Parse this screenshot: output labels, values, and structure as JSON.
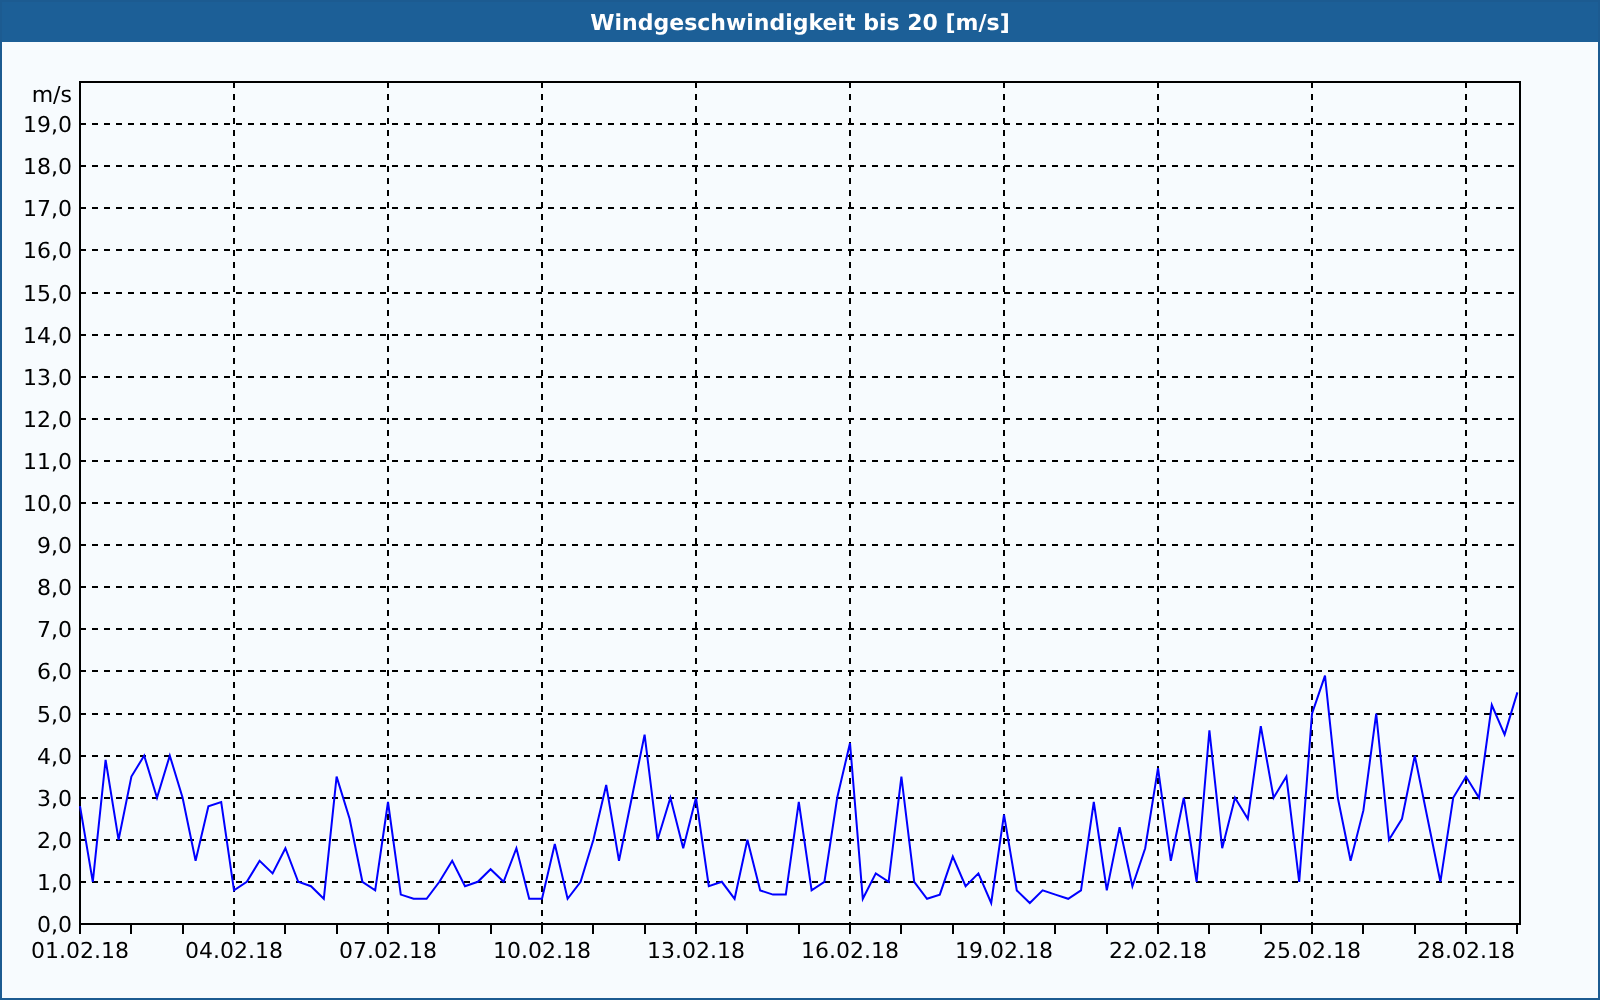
{
  "window": {
    "title": "Windgeschwindigkeit bis 20 [m/s]"
  },
  "chart_data": {
    "type": "line",
    "grid": true,
    "ylabel": "m/s",
    "ylim": [
      0,
      20
    ],
    "yticks": [
      {
        "value": 0,
        "label": "0,0"
      },
      {
        "value": 1,
        "label": "1,0"
      },
      {
        "value": 2,
        "label": "2,0"
      },
      {
        "value": 3,
        "label": "3,0"
      },
      {
        "value": 4,
        "label": "4,0"
      },
      {
        "value": 5,
        "label": "5,0"
      },
      {
        "value": 6,
        "label": "6,0"
      },
      {
        "value": 7,
        "label": "7,0"
      },
      {
        "value": 8,
        "label": "8,0"
      },
      {
        "value": 9,
        "label": "9,0"
      },
      {
        "value": 10,
        "label": "10,0"
      },
      {
        "value": 11,
        "label": "11,0"
      },
      {
        "value": 12,
        "label": "12,0"
      },
      {
        "value": 13,
        "label": "13,0"
      },
      {
        "value": 14,
        "label": "14,0"
      },
      {
        "value": 15,
        "label": "15,0"
      },
      {
        "value": 16,
        "label": "16,0"
      },
      {
        "value": 17,
        "label": "17,0"
      },
      {
        "value": 18,
        "label": "18,0"
      },
      {
        "value": 19,
        "label": "19,0"
      }
    ],
    "categories": [
      "01.02.18",
      null,
      null,
      null,
      null,
      null,
      null,
      null,
      null,
      null,
      null,
      null,
      "04.02.18",
      null,
      null,
      null,
      null,
      null,
      null,
      null,
      null,
      null,
      null,
      null,
      "07.02.18",
      null,
      null,
      null,
      null,
      null,
      null,
      null,
      null,
      null,
      null,
      null,
      "10.02.18",
      null,
      null,
      null,
      null,
      null,
      null,
      null,
      null,
      null,
      null,
      null,
      "13.02.18",
      null,
      null,
      null,
      null,
      null,
      null,
      null,
      null,
      null,
      null,
      null,
      "16.02.18",
      null,
      null,
      null,
      null,
      null,
      null,
      null,
      null,
      null,
      null,
      null,
      "19.02.18",
      null,
      null,
      null,
      null,
      null,
      null,
      null,
      null,
      null,
      null,
      null,
      "22.02.18",
      null,
      null,
      null,
      null,
      null,
      null,
      null,
      null,
      null,
      null,
      null,
      "25.02.18",
      null,
      null,
      null,
      null,
      null,
      null,
      null,
      null,
      null,
      null,
      null,
      "28.02.18",
      null,
      null,
      null,
      null
    ],
    "series": [
      {
        "color": "#0000ff",
        "values": [
          2.8,
          1.0,
          3.9,
          2.0,
          3.5,
          4.0,
          3.0,
          4.0,
          3.0,
          1.5,
          2.8,
          2.9,
          0.8,
          1.0,
          1.5,
          1.2,
          1.8,
          1.0,
          0.9,
          0.6,
          3.5,
          2.5,
          1.0,
          0.8,
          2.9,
          0.7,
          0.6,
          0.6,
          1.0,
          1.5,
          0.9,
          1.0,
          1.3,
          1.0,
          1.8,
          0.6,
          0.6,
          1.9,
          0.6,
          1.0,
          2.0,
          3.3,
          1.5,
          3.0,
          4.5,
          2.0,
          3.0,
          1.8,
          3.0,
          0.9,
          1.0,
          0.6,
          2.0,
          0.8,
          0.7,
          0.7,
          2.9,
          0.8,
          1.0,
          3.0,
          4.3,
          0.6,
          1.2,
          1.0,
          3.5,
          1.0,
          0.6,
          0.7,
          1.6,
          0.9,
          1.2,
          0.5,
          2.6,
          0.8,
          0.5,
          0.8,
          0.7,
          0.6,
          0.8,
          2.9,
          0.8,
          2.3,
          0.9,
          1.8,
          3.7,
          1.5,
          3.0,
          1.0,
          4.6,
          1.8,
          3.0,
          2.5,
          4.7,
          3.0,
          3.5,
          1.0,
          5.0,
          5.9,
          3.0,
          1.5,
          2.7,
          5.0,
          2.0,
          2.5,
          4.0,
          2.5,
          1.0,
          3.0,
          3.5,
          3.0,
          5.2,
          4.5,
          5.5
        ]
      }
    ]
  }
}
